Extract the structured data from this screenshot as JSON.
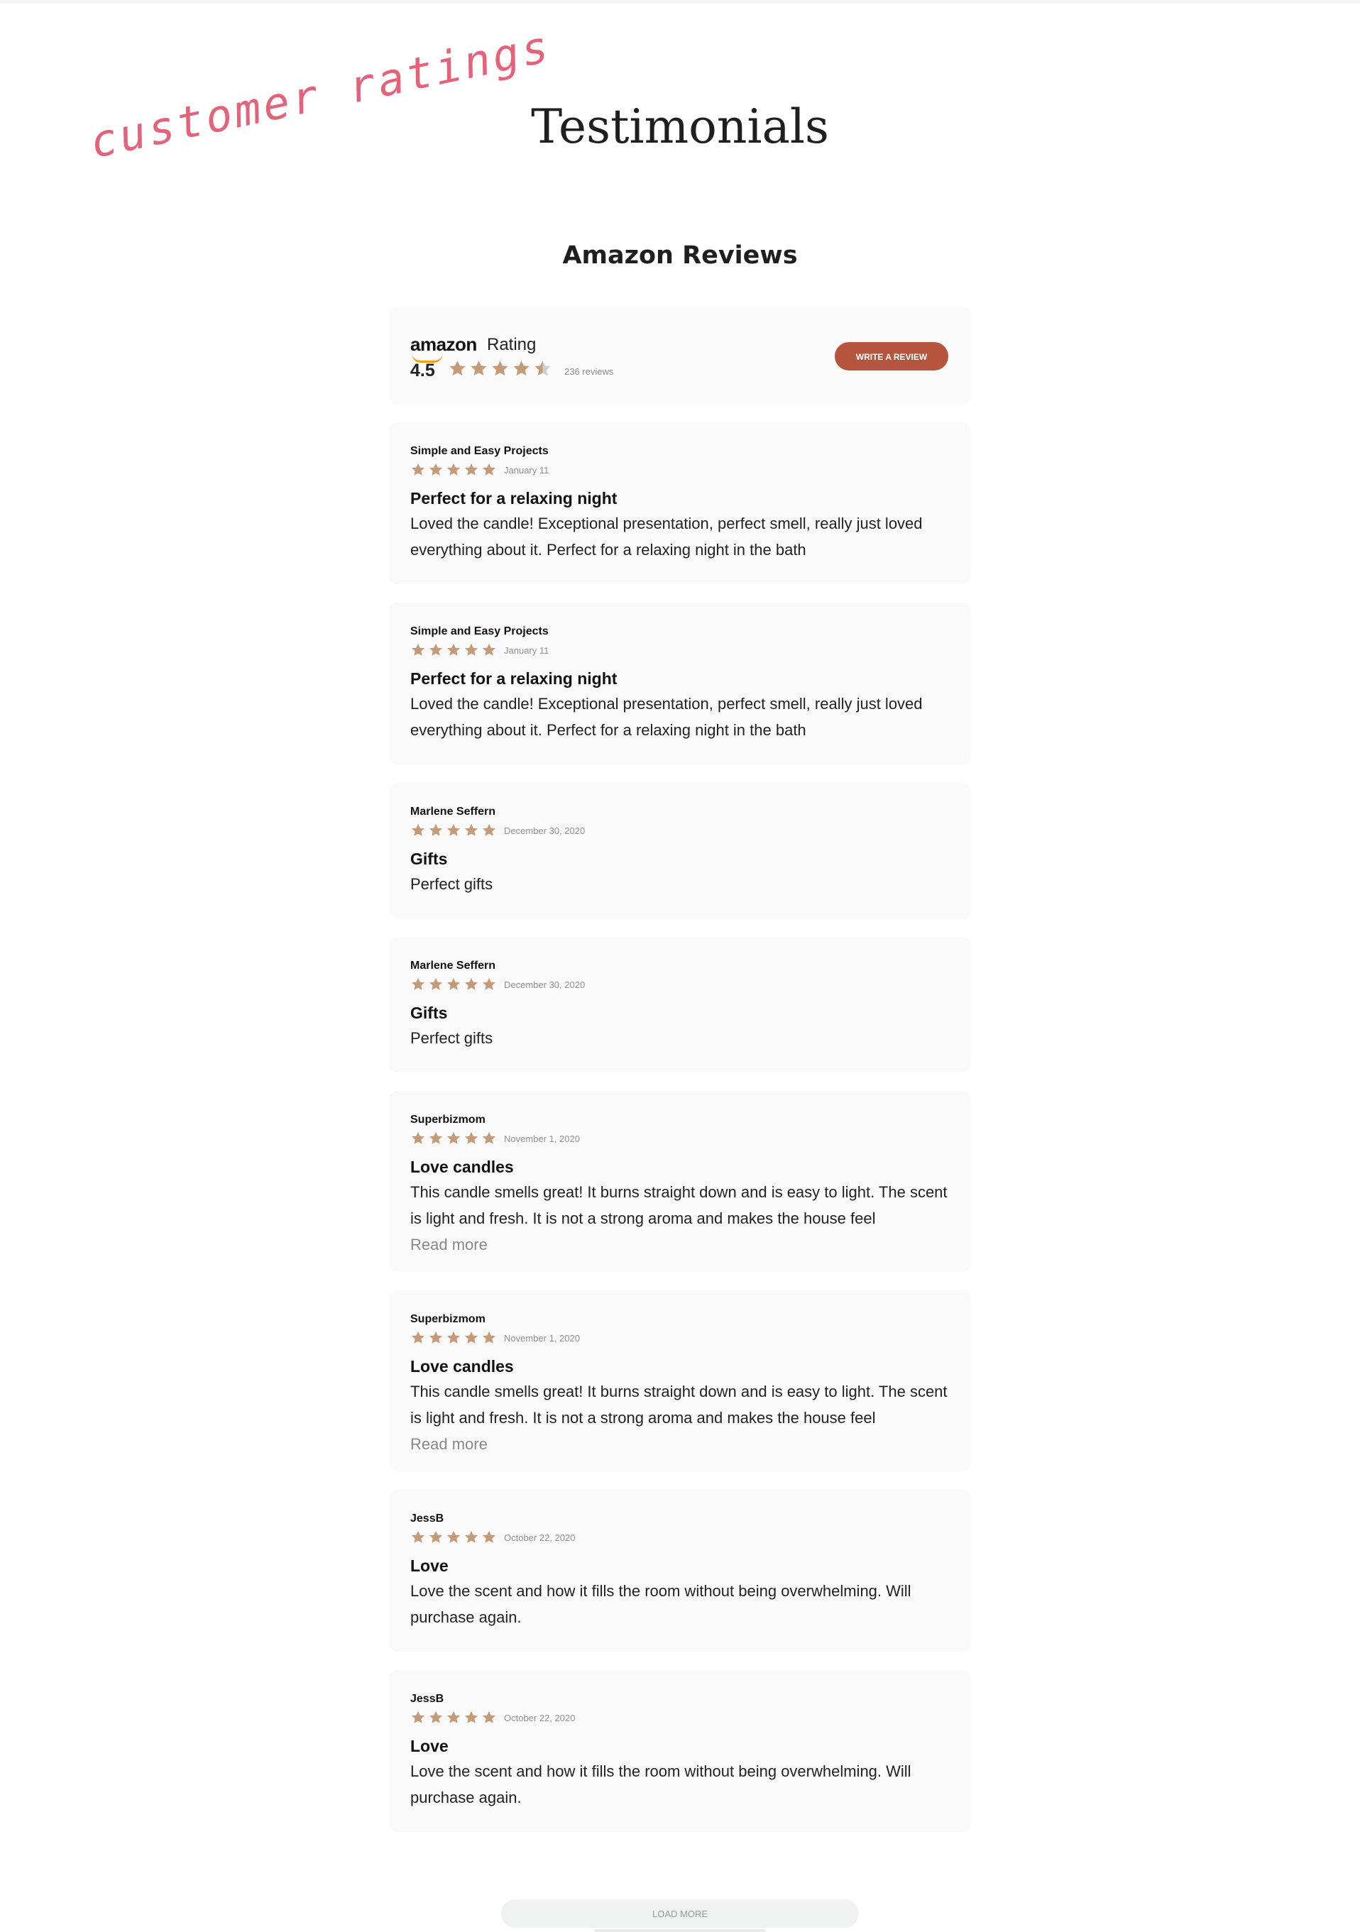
{
  "page": {
    "annotation": "customer ratings",
    "title": "Testimonials"
  },
  "widget": {
    "heading": "Amazon Reviews",
    "brand": "amazon",
    "rating_label": "Rating",
    "average": "4.5",
    "average_value": 4.5,
    "review_count_text": "236 reviews",
    "write_button_label": "Write a review",
    "load_more_label": "Load more",
    "read_more_label": "Read more"
  },
  "colors": {
    "star_filled": "#c49a78",
    "star_empty": "#cfcfcf",
    "button_bg": "#b5553d",
    "annotation": "#e5637a",
    "card_bg": "#fafafa"
  },
  "reviews": [
    {
      "author": "Simple and Easy Projects",
      "rating": 5,
      "date": "January 11",
      "title": "Perfect for a relaxing night",
      "body": "Loved the candle! Exceptional presentation, perfect smell, really just loved everything about it. Perfect for a relaxing night in the bath",
      "truncated": false
    },
    {
      "author": "Simple and Easy Projects",
      "rating": 5,
      "date": "January 11",
      "title": "Perfect for a relaxing night",
      "body": "Loved the candle! Exceptional presentation, perfect smell, really just loved everything about it. Perfect for a relaxing night in the bath",
      "truncated": false
    },
    {
      "author": "Marlene Seffern",
      "rating": 5,
      "date": "December 30, 2020",
      "title": "Gifts",
      "body": "Perfect gifts",
      "truncated": false
    },
    {
      "author": "Marlene Seffern",
      "rating": 5,
      "date": "December 30, 2020",
      "title": "Gifts",
      "body": "Perfect gifts",
      "truncated": false
    },
    {
      "author": "Superbizmom",
      "rating": 5,
      "date": "November 1, 2020",
      "title": "Love candles",
      "body": "This candle smells great! It burns straight down and is easy to light. The scent is light and fresh. It is not a strong aroma and makes the house feel",
      "truncated": true
    },
    {
      "author": "Superbizmom",
      "rating": 5,
      "date": "November 1, 2020",
      "title": "Love candles",
      "body": "This candle smells great! It burns straight down and is easy to light. The scent is light and fresh. It is not a strong aroma and makes the house feel",
      "truncated": true
    },
    {
      "author": "JessB",
      "rating": 5,
      "date": "October 22, 2020",
      "title": "Love",
      "body": "Love the scent and how it fills the room without being overwhelming. Will purchase again.",
      "truncated": false
    },
    {
      "author": "JessB",
      "rating": 5,
      "date": "October 22, 2020",
      "title": "Love",
      "body": "Love the scent and how it fills the room without being overwhelming. Will purchase again.",
      "truncated": false
    }
  ]
}
